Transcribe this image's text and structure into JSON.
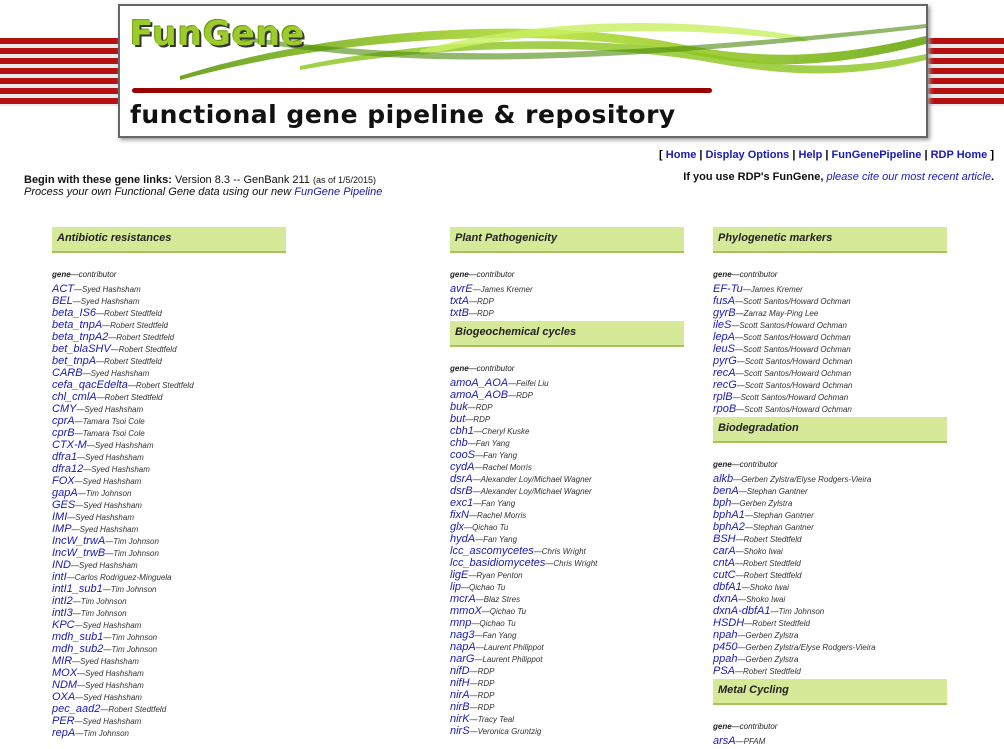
{
  "banner": {
    "logo": "FunGene",
    "tagline": "functional gene pipeline & repository"
  },
  "nav": {
    "open": "[",
    "close": "]",
    "sep": "|",
    "items": [
      "Home",
      "Display Options",
      "Help",
      "FunGenePipeline",
      "RDP Home"
    ]
  },
  "cite": {
    "prefix": "If you use RDP's FunGene,",
    "link": "please cite our most recent article",
    "suffix": "."
  },
  "intro": {
    "bold": "Begin with these gene links:",
    "version": "Version 8.3 -- GenBank 211",
    "asof": "(as of 1/5/2015)",
    "line2": "Process your own Functional Gene data using our new",
    "pipeline_link": "FunGene Pipeline"
  },
  "colhdr": {
    "gene": "gene",
    "contributor": "—contributor"
  },
  "columns": [
    {
      "sections": [
        {
          "title": "Antibiotic resistances",
          "genes": [
            [
              "ACT",
              "Syed Hashsham"
            ],
            [
              "BEL",
              "Syed Hashsham"
            ],
            [
              "beta_IS6",
              "Robert Stedtfeld"
            ],
            [
              "beta_tnpA",
              "Robert Stedtfeld"
            ],
            [
              "beta_tnpA2",
              "Robert Stedtfeld"
            ],
            [
              "bet_blaSHV",
              "Robert Stedtfeld"
            ],
            [
              "bet_tnpA",
              "Robert Stedtfeld"
            ],
            [
              "CARB",
              "Syed Hashsham"
            ],
            [
              "cefa_qacEdelta",
              "Robert Stedtfeld"
            ],
            [
              "chl_cmlA",
              "Robert Stedtfeld"
            ],
            [
              "CMY",
              "Syed Hashsham"
            ],
            [
              "cprA",
              "Tamara Tsoi Cole"
            ],
            [
              "cprB",
              "Tamara Tsoi Cole"
            ],
            [
              "CTX-M",
              "Syed Hashsham"
            ],
            [
              "dfra1",
              "Syed Hashsham"
            ],
            [
              "dfra12",
              "Syed Hashsham"
            ],
            [
              "FOX",
              "Syed Hashsham"
            ],
            [
              "gapA",
              "Tim Johnson"
            ],
            [
              "GES",
              "Syed Hashsham"
            ],
            [
              "IMI",
              "Syed Hashsham"
            ],
            [
              "IMP",
              "Syed Hashsham"
            ],
            [
              "IncW_trwA",
              "Tim Johnson"
            ],
            [
              "IncW_trwB",
              "Tim Johnson"
            ],
            [
              "IND",
              "Syed Hashsham"
            ],
            [
              "intI",
              "Carlos Rodriguez-Minguela"
            ],
            [
              "intI1_sub1",
              "Tim Johnson"
            ],
            [
              "intI2",
              "Tim Johnson"
            ],
            [
              "intI3",
              "Tim Johnson"
            ],
            [
              "KPC",
              "Syed Hashsham"
            ],
            [
              "mdh_sub1",
              "Tim Johnson"
            ],
            [
              "mdh_sub2",
              "Tim Johnson"
            ],
            [
              "MIR",
              "Syed Hashsham"
            ],
            [
              "MOX",
              "Syed Hashsham"
            ],
            [
              "NDM",
              "Syed Hashsham"
            ],
            [
              "OXA",
              "Syed Hashsham"
            ],
            [
              "pec_aad2",
              "Robert Stedtfeld"
            ],
            [
              "PER",
              "Syed Hashsham"
            ],
            [
              "repA",
              "Tim Johnson"
            ]
          ]
        }
      ]
    },
    {
      "sections": [
        {
          "title": "Plant Pathogenicity",
          "genes": [
            [
              "avrE",
              "James Kremer"
            ],
            [
              "txtA",
              "RDP"
            ],
            [
              "txtB",
              "RDP"
            ]
          ]
        },
        {
          "title": "Biogeochemical cycles",
          "genes": [
            [
              "amoA_AOA",
              "Feifei Liu"
            ],
            [
              "amoA_AOB",
              "RDP"
            ],
            [
              "buk",
              "RDP"
            ],
            [
              "but",
              "RDP"
            ],
            [
              "cbh1",
              "Cheryl Kuske"
            ],
            [
              "chb",
              "Fan Yang"
            ],
            [
              "cooS",
              "Fan Yang"
            ],
            [
              "cydA",
              "Rachel Morris"
            ],
            [
              "dsrA",
              "Alexander Loy/Michael Wagner"
            ],
            [
              "dsrB",
              "Alexander Loy/Michael Wagner"
            ],
            [
              "exc1",
              "Fan Yang"
            ],
            [
              "fixN",
              "Rachel Morris"
            ],
            [
              "glx",
              "Qichao Tu"
            ],
            [
              "hydA",
              "Fan Yang"
            ],
            [
              "lcc_ascomycetes",
              "Chris Wright"
            ],
            [
              "lcc_basidiomycetes",
              "Chris Wright"
            ],
            [
              "ligE",
              "Ryan Penton"
            ],
            [
              "lip",
              "Qichao Tu"
            ],
            [
              "mcrA",
              "Blaz Stres"
            ],
            [
              "mmoX",
              "Qichao Tu"
            ],
            [
              "mnp",
              "Qichao Tu"
            ],
            [
              "nag3",
              "Fan Yang"
            ],
            [
              "napA",
              "Laurent Philippot"
            ],
            [
              "narG",
              "Laurent Philippot"
            ],
            [
              "nifD",
              "RDP"
            ],
            [
              "nifH",
              "RDP"
            ],
            [
              "nirA",
              "RDP"
            ],
            [
              "nirB",
              "RDP"
            ],
            [
              "nirK",
              "Tracy Teal"
            ],
            [
              "nirS",
              "Veronica Gruntzig"
            ]
          ]
        }
      ]
    },
    {
      "sections": [
        {
          "title": "Phylogenetic markers",
          "genes": [
            [
              "EF-Tu",
              "James Kremer"
            ],
            [
              "fusA",
              "Scott Santos/Howard Ochman"
            ],
            [
              "gyrB",
              "Zarraz May-Ping Lee"
            ],
            [
              "ileS",
              "Scott Santos/Howard Ochman"
            ],
            [
              "lepA",
              "Scott Santos/Howard Ochman"
            ],
            [
              "leuS",
              "Scott Santos/Howard Ochman"
            ],
            [
              "pyrG",
              "Scott Santos/Howard Ochman"
            ],
            [
              "recA",
              "Scott Santos/Howard Ochman"
            ],
            [
              "recG",
              "Scott Santos/Howard Ochman"
            ],
            [
              "rplB",
              "Scott Santos/Howard Ochman"
            ],
            [
              "rpoB",
              "Scott Santos/Howard Ochman"
            ]
          ]
        },
        {
          "title": "Biodegradation",
          "genes": [
            [
              "alkb",
              "Gerben Zylstra/Elyse Rodgers-Vieira"
            ],
            [
              "benA",
              "Stephan Gantner"
            ],
            [
              "bph",
              "Gerben Zylstra"
            ],
            [
              "bphA1",
              "Stephan Gantner"
            ],
            [
              "bphA2",
              "Stephan Gantner"
            ],
            [
              "BSH",
              "Robert Stedtfeld"
            ],
            [
              "carA",
              "Shoko Iwai"
            ],
            [
              "cntA",
              "Robert Stedtfeld"
            ],
            [
              "cutC",
              "Robert Stedtfeld"
            ],
            [
              "dbfA1",
              "Shoko Iwai"
            ],
            [
              "dxnA",
              "Shoko Iwai"
            ],
            [
              "dxnA-dbfA1",
              "Tim Johnson"
            ],
            [
              "HSDH",
              "Robert Stedtfeld"
            ],
            [
              "npah",
              "Gerben Zylstra"
            ],
            [
              "p450",
              "Gerben Zylstra/Elyse Rodgers-Vieira"
            ],
            [
              "ppah",
              "Gerben Zylstra"
            ],
            [
              "PSA",
              "Robert Stedtfeld"
            ]
          ]
        },
        {
          "title": "Metal Cycling",
          "genes": [
            [
              "arsA",
              "PFAM"
            ]
          ]
        }
      ]
    }
  ]
}
